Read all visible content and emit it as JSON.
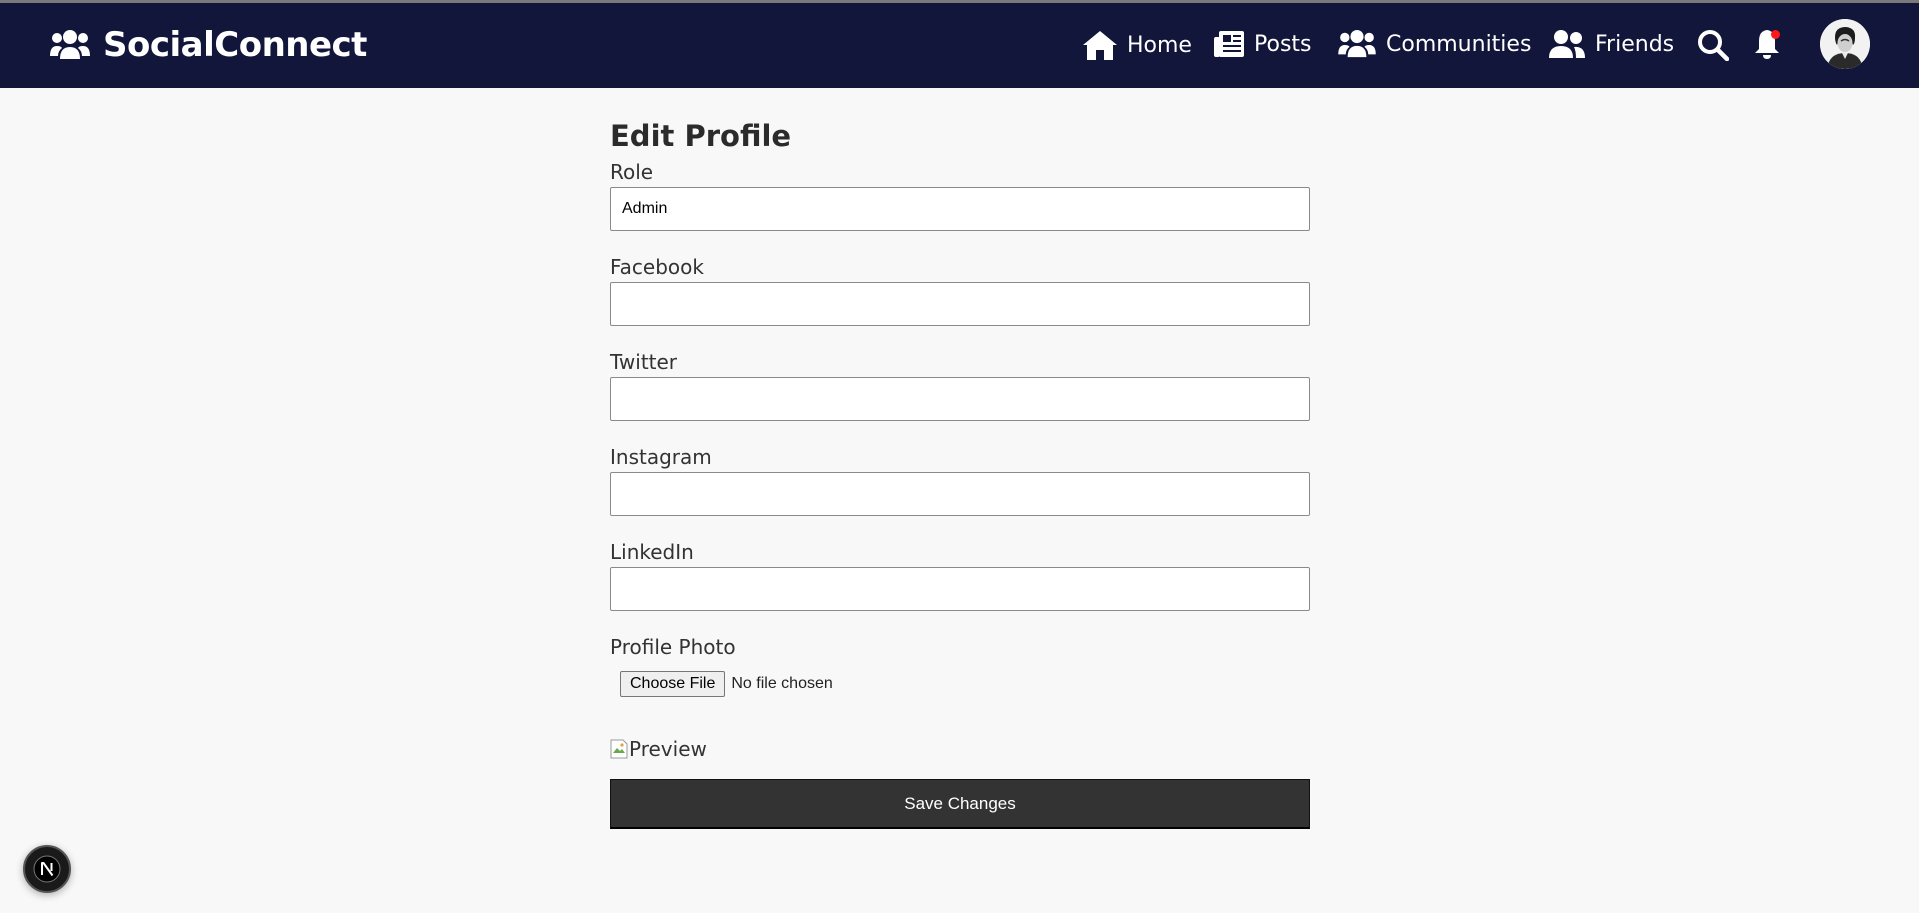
{
  "brand": {
    "name": "SocialConnect",
    "icon": "users-icon"
  },
  "nav": {
    "items": [
      {
        "label": "Home",
        "icon": "home-icon"
      },
      {
        "label": "Posts",
        "icon": "newspaper-icon"
      },
      {
        "label": "Communities",
        "icon": "users-icon"
      },
      {
        "label": "Friends",
        "icon": "user-friends-icon"
      }
    ],
    "search_icon": "search-icon",
    "notification_icon": "bell-icon",
    "has_unread_notification": true,
    "avatar_icon": "user-avatar"
  },
  "form": {
    "title": "Edit Profile",
    "fields": [
      {
        "label": "Role",
        "value": "Admin"
      },
      {
        "label": "Facebook",
        "value": ""
      },
      {
        "label": "Twitter",
        "value": ""
      },
      {
        "label": "Instagram",
        "value": ""
      },
      {
        "label": "LinkedIn",
        "value": ""
      }
    ],
    "photo": {
      "label": "Profile Photo",
      "button_label": "Choose File",
      "status": "No file chosen",
      "preview_alt": "Preview"
    },
    "submit_label": "Save Changes"
  },
  "dev_badge": {
    "letter": "N"
  },
  "colors": {
    "navbar": "#11163a",
    "accent_button": "#333333",
    "page_bg": "#f8f8f8",
    "notification_dot": "#ff1a1a"
  }
}
